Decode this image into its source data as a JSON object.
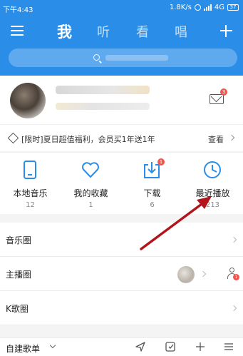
{
  "status_bar": {
    "time": "下午4:43",
    "network_speed": "1.8K/s",
    "network_type": "4G",
    "battery": "37"
  },
  "nav": {
    "tabs": [
      {
        "label": "我"
      },
      {
        "label": "听"
      },
      {
        "label": "看"
      },
      {
        "label": "唱"
      }
    ],
    "active_tab": "我"
  },
  "profile": {
    "mail_badge": "3"
  },
  "promo": {
    "text": "[限时]夏日超值福利，会员买1年送1年",
    "link": "查看"
  },
  "quick_access": [
    {
      "label": "本地音乐",
      "count": "12",
      "icon": "phone-icon"
    },
    {
      "label": "我的收藏",
      "count": "1",
      "icon": "heart-icon"
    },
    {
      "label": "下载",
      "count": "6",
      "icon": "download-icon",
      "badge": "1"
    },
    {
      "label": "最近播放",
      "count": "213",
      "icon": "clock-icon"
    }
  ],
  "annotation": {
    "color": "#b3141c"
  },
  "list": [
    {
      "label": "音乐圈"
    },
    {
      "label": "主播圈",
      "badge": "1"
    },
    {
      "label": "K歌圈"
    }
  ],
  "bottom": {
    "label": "自建歌单"
  },
  "colors": {
    "brand": "#2a8ee8",
    "badge": "#f2554d"
  }
}
